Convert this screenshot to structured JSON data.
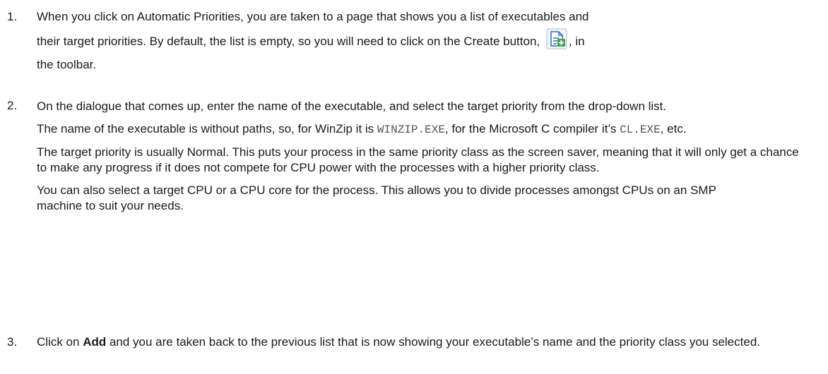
{
  "steps": [
    {
      "number": "1.",
      "line1": "When you click on Automatic Priorities, you are taken to a page that shows you a list of executables and",
      "line2_pre": "their target priorities. By default, the list is empty, so you will need to click on the Create button, ",
      "line2_post": ", in",
      "line3": "the toolbar.",
      "icon": "create-icon"
    },
    {
      "number": "2.",
      "intro": "On the dialogue that comes up, enter the name of the executable, and select the target priority from the drop-down list.",
      "names_pre": "The name of the executable is without paths, so, for WinZip it is ",
      "names_code1": "WINZIP.EXE",
      "names_mid": ", for the Microsoft C compiler it’s ",
      "names_code2": "CL.EXE",
      "names_post": ", etc.",
      "priority_text": "The target priority is usually Normal. This puts your process in the same priority class as the screen saver, meaning that it will only get a chance to make any progress if it does not compete for CPU power with the processes with a higher priority class.",
      "cpu_text": "You can also select a target CPU or a CPU core for the process. This allows you to divide processes amongst CPUs on an SMP machine to suit your needs."
    },
    {
      "number": "3.",
      "pre": "Click on ",
      "bold": "Add",
      "post": " and you are taken back to the previous list that is now showing your executable’s name and the priority class you selected."
    }
  ],
  "colors": {
    "text": "#1a1a1a",
    "code": "#555555",
    "icon_blue": "#2e6bb5",
    "icon_green": "#3fa34d"
  }
}
